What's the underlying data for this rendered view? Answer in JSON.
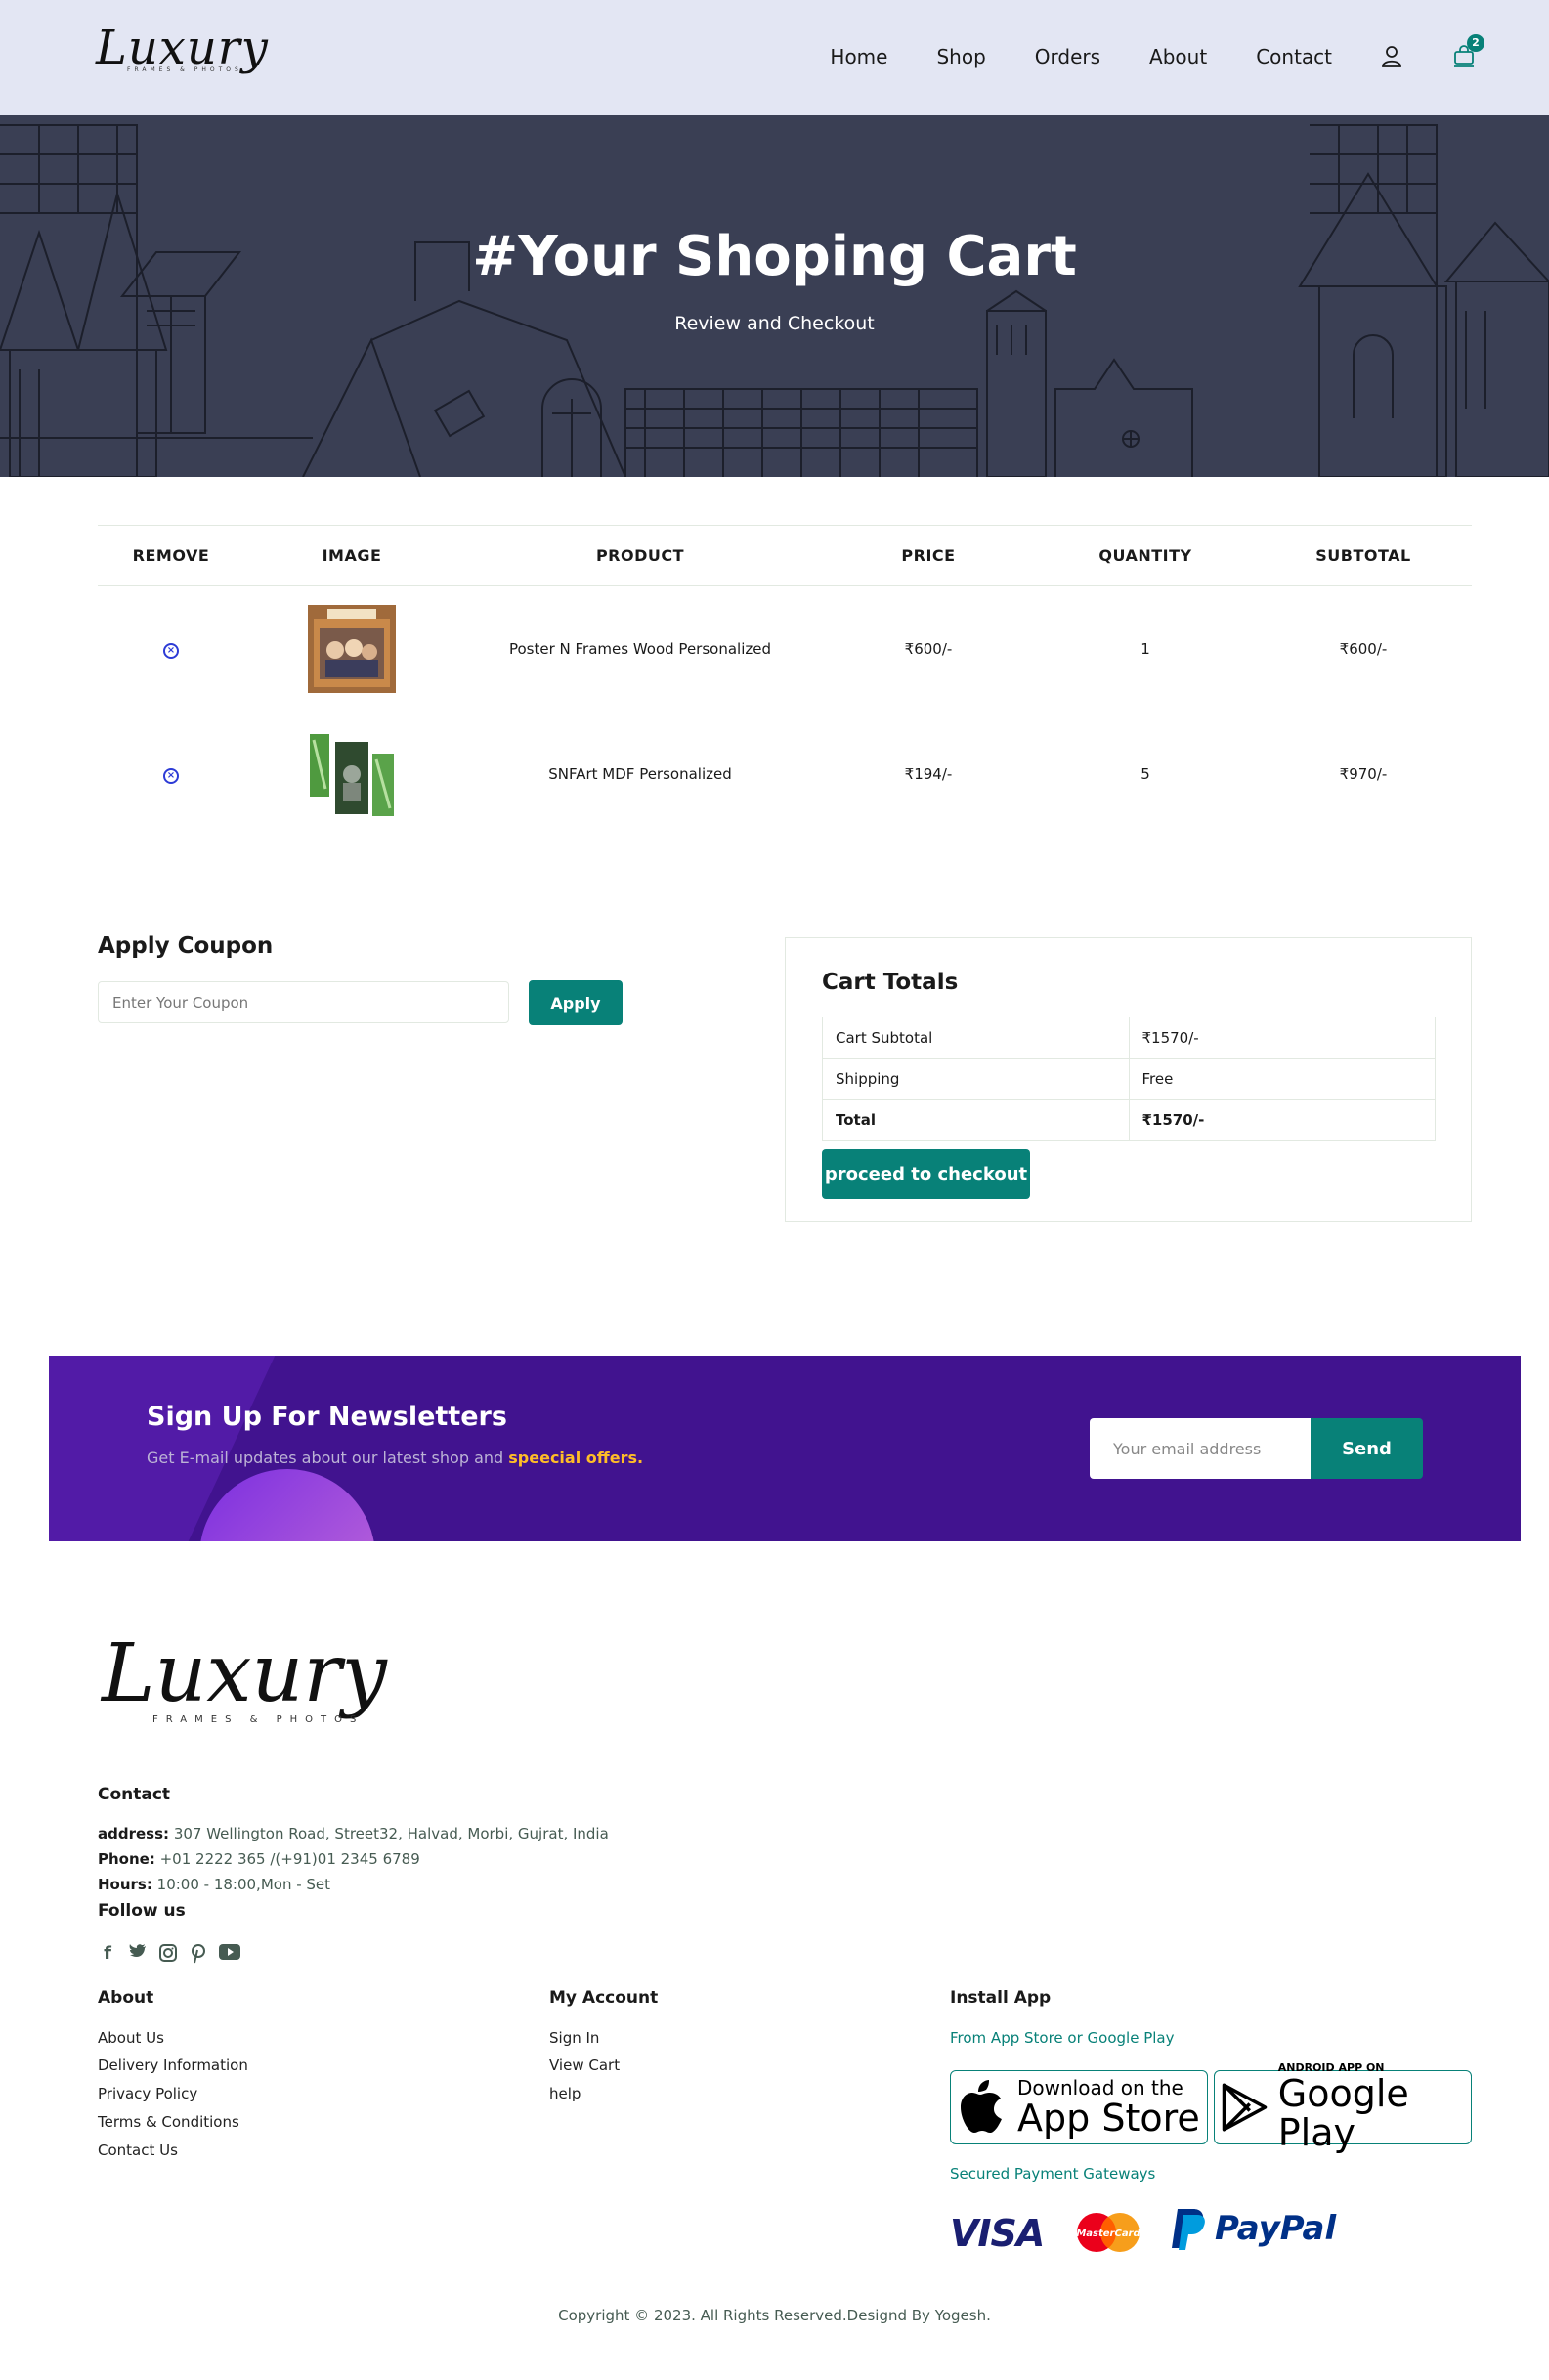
{
  "brand": {
    "logo_script": "Luxury",
    "logo_sub": "FRAMES & PHOTOS"
  },
  "nav": {
    "items": [
      "Home",
      "Shop",
      "Orders",
      "About",
      "Contact"
    ],
    "cart_count": "2"
  },
  "hero": {
    "title": "#Your Shoping Cart",
    "subtitle": "Review and Checkout"
  },
  "cart": {
    "headers": [
      "REMOVE",
      "IMAGE",
      "PRODUCT",
      "PRICE",
      "QUANTITY",
      "SUBTOTAL"
    ],
    "rows": [
      {
        "product": "Poster N Frames Wood Personalized",
        "price": "₹600/-",
        "quantity": "1",
        "subtotal": "₹600/-"
      },
      {
        "product": "SNFArt MDF Personalized",
        "price": "₹194/-",
        "quantity": "5",
        "subtotal": "₹970/-"
      }
    ]
  },
  "coupon": {
    "title": "Apply Coupon",
    "placeholder": "Enter Your Coupon",
    "button": "Apply"
  },
  "totals": {
    "title": "Cart Totals",
    "rows": [
      {
        "label": "Cart Subtotal",
        "value": "₹1570/-"
      },
      {
        "label": "Shipping",
        "value": "Free"
      },
      {
        "label": "Total",
        "value": "₹1570/-"
      }
    ],
    "checkout_button": "proceed to checkout"
  },
  "newsletter": {
    "title": "Sign Up For Newsletters",
    "subtitle": "Get E-mail updates about our latest shop and",
    "highlight": "speecial offers.",
    "placeholder": "Your email address",
    "button": "Send"
  },
  "footer": {
    "contact_title": "Contact",
    "address_label": "address:",
    "address": "307 Wellington Road, Street32, Halvad, Morbi, Gujrat, India",
    "phone_label": "Phone:",
    "phone": "+01 2222 365 /(+91)01 2345 6789",
    "hours_label": "Hours:",
    "hours": "10:00 - 18:00,Mon - Set",
    "follow_title": "Follow us",
    "about_title": "About",
    "about_links": [
      "About Us",
      "Delivery Information",
      "Privacy Policy",
      "Terms & Conditions",
      "Contact Us"
    ],
    "account_title": "My Account",
    "account_links": [
      "Sign In",
      "View Cart",
      "help"
    ],
    "app_title": "Install App",
    "app_sub": "From App Store or Google Play",
    "appstore_small": "Download on the",
    "appstore_big": "App Store",
    "googleplay_small": "ANDROID APP ON",
    "googleplay_big": "Google Play",
    "payment_title": "Secured Payment Gateways",
    "payments": [
      "VISA",
      "MasterCard",
      "PayPal"
    ],
    "copyright": "Copyright © 2023. All Rights Reserved.Designd By Yogesh."
  },
  "colors": {
    "accent": "#088178",
    "nav_bg": "#e3e6f3",
    "hero_bg": "#3a3f54",
    "newsletter_bg": "#41138f",
    "highlight": "#ffbd27"
  }
}
